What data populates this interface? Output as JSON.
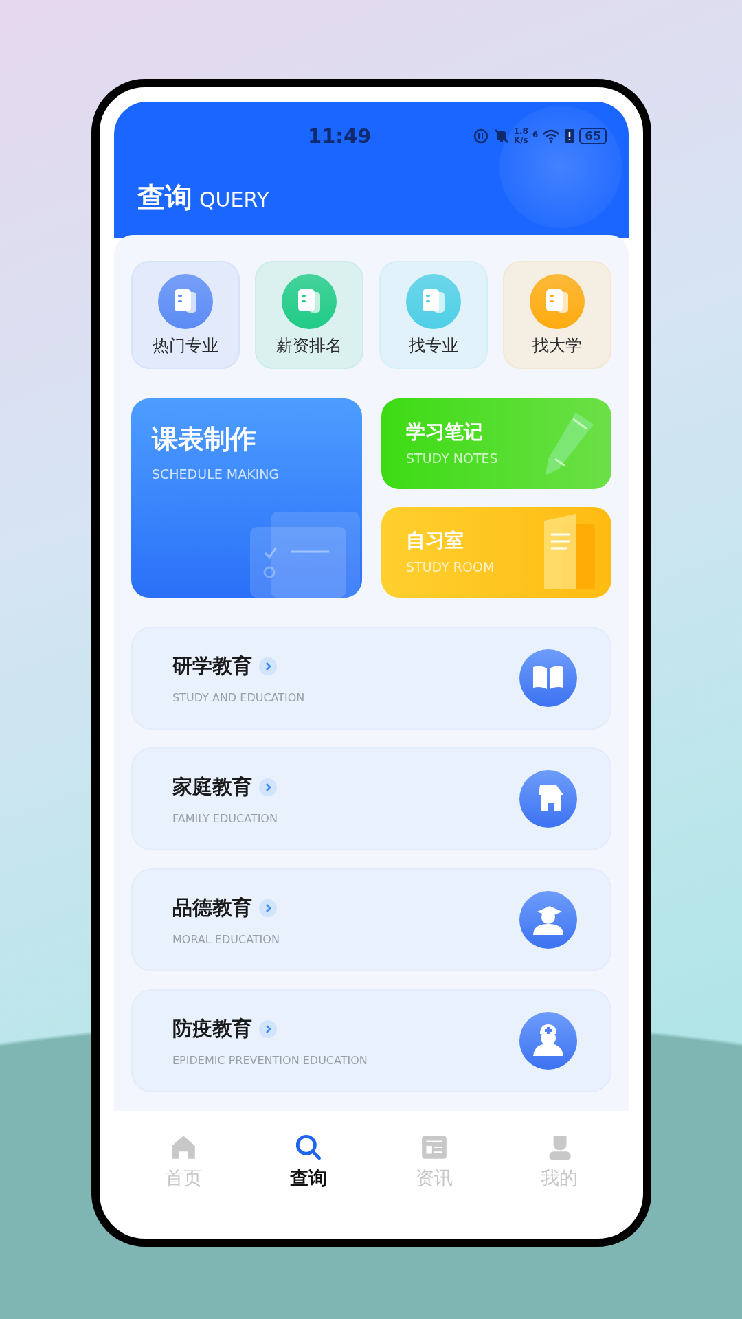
{
  "status_bar": {
    "time": "11:49",
    "speed_value": "1.8",
    "speed_unit": "K/s",
    "signal_label": "6",
    "battery": "65"
  },
  "header": {
    "title": "查询",
    "subtitle": "QUERY"
  },
  "quick_links": [
    {
      "label": "热门专业",
      "color": "#5b8cf5"
    },
    {
      "label": "薪资排名",
      "color": "#1fcb86"
    },
    {
      "label": "找专业",
      "color": "#4fcfe6"
    },
    {
      "label": "找大学",
      "color": "#ffab0f"
    }
  ],
  "feature_cards": [
    {
      "kind": "schedule",
      "title": "课表制作",
      "subtitle": "SCHEDULE MAKING"
    },
    {
      "kind": "notes",
      "title": "学习笔记",
      "subtitle": "STUDY NOTES"
    },
    {
      "kind": "room",
      "title": "自习室",
      "subtitle": "STUDY ROOM"
    }
  ],
  "sections": [
    {
      "kind": "book",
      "title": "研学教育",
      "subtitle": "STUDY AND EDUCATION"
    },
    {
      "kind": "home",
      "title": "家庭教育",
      "subtitle": "FAMILY EDUCATION"
    },
    {
      "kind": "graduate",
      "title": "品德教育",
      "subtitle": "MORAL EDUCATION"
    },
    {
      "kind": "nurse",
      "title": "防疫教育",
      "subtitle": "EPIDEMIC PREVENTION EDUCATION"
    }
  ],
  "tabs": [
    {
      "kind": "home",
      "label": "首页",
      "selected": false
    },
    {
      "kind": "search",
      "label": "查询",
      "selected": true
    },
    {
      "kind": "news",
      "label": "资讯",
      "selected": false
    },
    {
      "kind": "profile",
      "label": "我的",
      "selected": false
    }
  ]
}
